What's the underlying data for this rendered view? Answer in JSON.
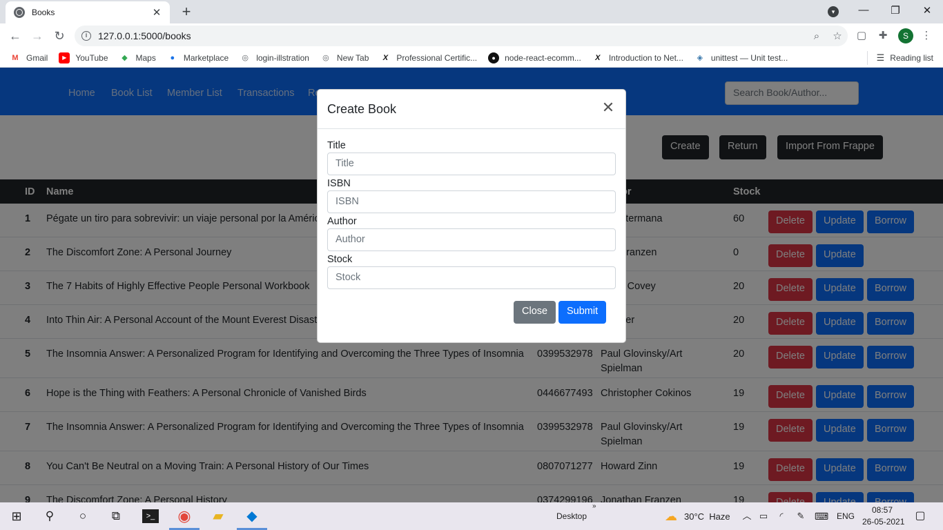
{
  "browser": {
    "tab_title": "Books",
    "tab_close": "✕",
    "new_tab": "+",
    "url": "127.0.0.1:5000/books",
    "profile_initial": "S",
    "bookmarks": [
      {
        "label": "Gmail",
        "icon": "gmail-icon"
      },
      {
        "label": "YouTube",
        "icon": "youtube-icon"
      },
      {
        "label": "Maps",
        "icon": "maps-icon"
      },
      {
        "label": "Marketplace",
        "icon": "marketplace-icon"
      },
      {
        "label": "login-illstration",
        "icon": "globe-icon"
      },
      {
        "label": "New Tab",
        "icon": "globe-icon"
      },
      {
        "label": "Professional Certific...",
        "icon": "edx-icon"
      },
      {
        "label": "node-react-ecomm...",
        "icon": "github-icon"
      },
      {
        "label": "Introduction to Net...",
        "icon": "edx-icon"
      },
      {
        "label": "unittest — Unit test...",
        "icon": "python-icon"
      }
    ],
    "reading_list": "Reading list"
  },
  "navbar": {
    "links": [
      "Home",
      "Book List",
      "Member List",
      "Transactions",
      "Re"
    ],
    "search_placeholder": "Search Book/Author..."
  },
  "actions": {
    "create": "Create",
    "return": "Return",
    "import": "Import From Frappe"
  },
  "table": {
    "headers": {
      "id": "ID",
      "name": "Name",
      "author": "or",
      "stock": "Stock"
    },
    "rows": [
      {
        "id": "1",
        "name": "Pégate un tiro para sobrevivir: un viaje personal por la América",
        "isbn": "",
        "author": ": Klostermana",
        "stock": "60",
        "borrow": true
      },
      {
        "id": "2",
        "name": "The Discomfort Zone: A Personal Journey",
        "isbn": "",
        "author": "han Franzen",
        "stock": "0",
        "borrow": false
      },
      {
        "id": "3",
        "name": "The 7 Habits of Highly Effective People Personal Workbook",
        "isbn": "",
        "author": "en R. Covey",
        "stock": "20",
        "borrow": true
      },
      {
        "id": "4",
        "name": "Into Thin Air: A Personal Account of the Mount Everest Disaste",
        "isbn": "",
        "author": "rakauer",
        "stock": "20",
        "borrow": true
      },
      {
        "id": "5",
        "name": "The Insomnia Answer: A Personalized Program for Identifying and Overcoming the Three Types of Insomnia",
        "isbn": "0399532978",
        "author": "Paul Glovinsky/Art Spielman",
        "stock": "20",
        "borrow": true
      },
      {
        "id": "6",
        "name": "Hope is the Thing with Feathers: A Personal Chronicle of Vanished Birds",
        "isbn": "0446677493",
        "author": "Christopher Cokinos",
        "stock": "19",
        "borrow": true
      },
      {
        "id": "7",
        "name": "The Insomnia Answer: A Personalized Program for Identifying and Overcoming the Three Types of Insomnia",
        "isbn": "0399532978",
        "author": "Paul Glovinsky/Art Spielman",
        "stock": "19",
        "borrow": true
      },
      {
        "id": "8",
        "name": "You Can't Be Neutral on a Moving Train: A Personal History of Our Times",
        "isbn": "0807071277",
        "author": "Howard Zinn",
        "stock": "19",
        "borrow": true
      },
      {
        "id": "9",
        "name": "The Discomfort Zone: A Personal History",
        "isbn": "0374299196",
        "author": "Jonathan Franzen",
        "stock": "19",
        "borrow": true
      }
    ],
    "delete_label": "Delete",
    "update_label": "Update",
    "borrow_label": "Borrow"
  },
  "modal": {
    "title": "Create Book",
    "close_icon": "✕",
    "fields": [
      {
        "label": "Title",
        "placeholder": "Title"
      },
      {
        "label": "ISBN",
        "placeholder": "ISBN"
      },
      {
        "label": "Author",
        "placeholder": "Author"
      },
      {
        "label": "Stock",
        "placeholder": "Stock"
      }
    ],
    "close_button": "Close",
    "submit_button": "Submit"
  },
  "taskbar": {
    "desktop_label": "Desktop",
    "chevron": "»",
    "weather": "30°C  Haze",
    "language": "ENG",
    "time": "08:57",
    "date": "26-05-2021"
  },
  "colors": {
    "primary": "#0d6efd",
    "danger": "#dc3545",
    "secondary": "#6c757d",
    "dark": "#212529"
  }
}
